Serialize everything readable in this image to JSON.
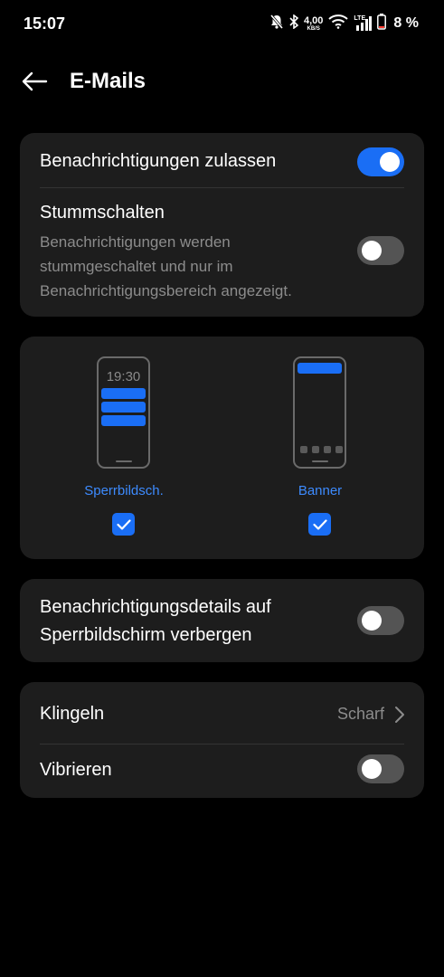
{
  "status_bar": {
    "time": "15:07",
    "net_speed_value": "4,00",
    "net_speed_unit": "KB/S",
    "network_type": "LTE",
    "battery": "8 %"
  },
  "header": {
    "title": "E-Mails"
  },
  "card1": {
    "allow_label": "Benachrichtigungen zulassen",
    "allow_on": true,
    "mute_label": "Stummschalten",
    "mute_description": "Benachrichtigungen werden stummgeschaltet und nur im Benachrichtigungsbereich angezeigt.",
    "mute_on": false
  },
  "display_options": [
    {
      "preview_time": "19:30",
      "label": "Sperrbildsch.",
      "checked": true
    },
    {
      "label": "Banner",
      "checked": true
    }
  ],
  "card3": {
    "hide_details_label": "Benachrichtigungsdetails auf Sperrbildschirm verbergen",
    "hide_details_on": false
  },
  "card4": {
    "ring_label": "Klingeln",
    "ring_value": "Scharf",
    "vibrate_label": "Vibrieren",
    "vibrate_on": false
  },
  "colors": {
    "accent": "#1a6ef5",
    "card_bg": "#1d1d1d",
    "accent_text": "#3d8bff"
  }
}
